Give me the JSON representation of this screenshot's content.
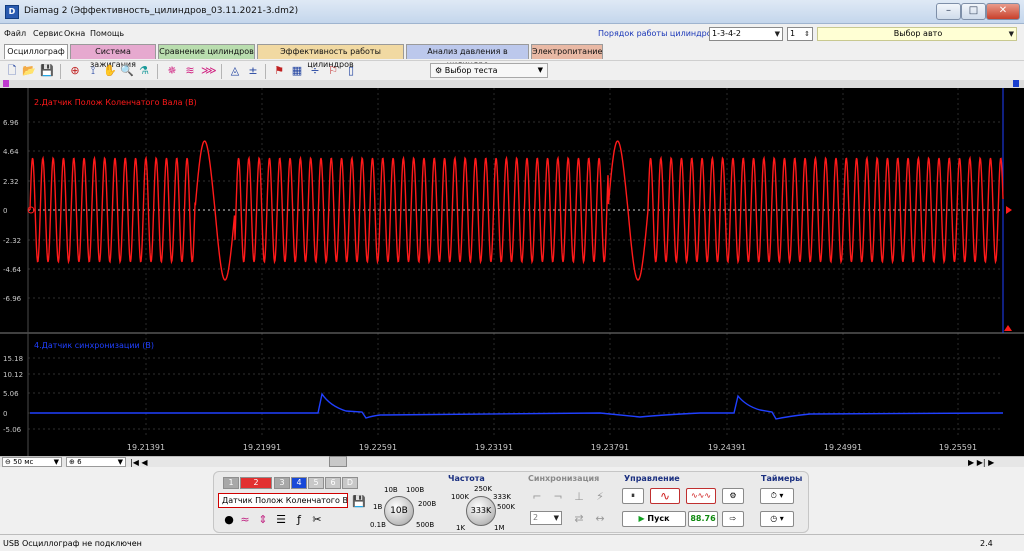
{
  "window": {
    "title": "Diamag 2 (Эффективность_цилиндров_03.11.2021-3.dm2)",
    "app_icon": "diamag-app-icon",
    "controls": [
      "–",
      "□",
      "✕"
    ]
  },
  "menu": {
    "items": [
      "Файл",
      "Сервис",
      "Окна",
      "Помощь"
    ],
    "cylinder_order_label": "Порядок работы цилиндров",
    "cylinder_order_value": "1-3-4-2",
    "cylinder_num_value": "1",
    "auto_select_label": "Выбор авто"
  },
  "tabs": [
    {
      "label": "Осциллограф",
      "color": "#ffffff",
      "active": true
    },
    {
      "label": "Система зажигания",
      "color": "#e6a9cf"
    },
    {
      "label": "Сравнение цилиндров",
      "color": "#b9ddae"
    },
    {
      "label": "Эффективность работы цилиндров",
      "color": "#f1d9a2"
    },
    {
      "label": "Анализ давления в цилиндре",
      "color": "#bcc8ec"
    },
    {
      "label": "Электропитание",
      "color": "#e9b9a5"
    }
  ],
  "toolbar": {
    "icons": [
      "new-file-icon",
      "open-folder-icon",
      "save-icon",
      "cursor-mode-icon",
      "pen-icon",
      "hand-pan-icon",
      "zoom-icon",
      "filter-icon",
      "burst-icon",
      "waves-icon",
      "spectrum-icon",
      "measure-icon",
      "zero-icon",
      "markers-icon",
      "table-icon",
      "split-icon",
      "flag-icon",
      "page-icon"
    ],
    "test_select_label": "Выбор теста"
  },
  "scope": {
    "channel1": {
      "label": "2.Датчик Полож Коленчатого Вала (В)",
      "color": "#ff1a1a",
      "y_ticks": [
        "6.96",
        "4.64",
        "2.32",
        "0",
        "-2.32",
        "-4.64",
        "-6.96"
      ]
    },
    "channel2": {
      "label": "4.Датчик синхронизации (В)",
      "color": "#2040ff",
      "y_ticks": [
        "15.18",
        "10.12",
        "5.06",
        "0",
        "-5.06"
      ]
    },
    "x_ticks": [
      "19.21391",
      "19.21991",
      "19.22591",
      "19.23191",
      "19.23791",
      "19.24391",
      "19.24991",
      "19.25591"
    ]
  },
  "timeline": {
    "scale_value": "50 мс",
    "channel_value": "6",
    "nav_left": "|◀ ◀",
    "nav_right": "▶ ▶| ▶"
  },
  "channels": {
    "buttons": [
      "1",
      "2",
      "3",
      "4",
      "5",
      "6",
      "D"
    ],
    "active_colors": [
      "#a8a8a8",
      "#e23030",
      "#a8a8a8",
      "#1848d8",
      "#c8c8c8",
      "#c8c8c8",
      "#c8c8c8"
    ],
    "sensor_name": "Датчик Полож Коленчатого Ва..."
  },
  "voltage_knob": {
    "value": "10В",
    "labels": [
      "0.1В",
      "1В",
      "10В",
      "100В",
      "200В",
      "500В"
    ]
  },
  "frequency": {
    "title": "Частота",
    "value": "333K",
    "labels": [
      "1K",
      "100K",
      "250K",
      "333K",
      "500K",
      "1M"
    ]
  },
  "sync": {
    "title": "Синхронизация",
    "channel_value": "2"
  },
  "control": {
    "title": "Управление",
    "start_label": "Пуск",
    "rpm_value": "88.76"
  },
  "timers": {
    "title": "Таймеры"
  },
  "status": {
    "text": "USB Осциллограф не подключен",
    "right_value": "2.4"
  }
}
